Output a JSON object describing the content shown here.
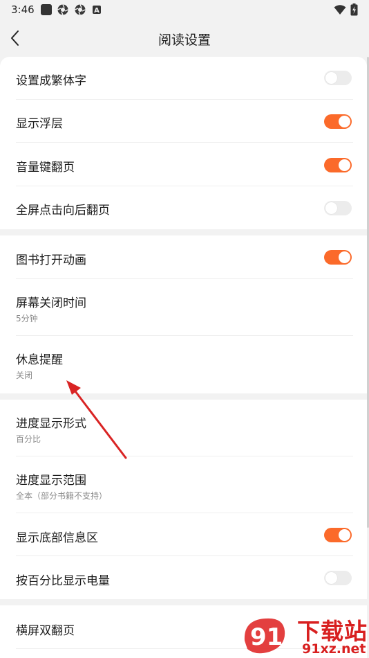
{
  "status_bar": {
    "time": "3:46",
    "icons": [
      "notification-square-icon",
      "aperture-icon",
      "aperture-icon",
      "a-badge-icon"
    ],
    "right_icons": [
      "wifi-icon",
      "battery-charging-icon"
    ]
  },
  "header": {
    "back_icon": "chevron-left-icon",
    "title": "阅读设置"
  },
  "accent_color": "#fb6a2a",
  "settings": {
    "traditional_chinese": {
      "label": "设置成繁体字",
      "enabled": false
    },
    "show_overlay": {
      "label": "显示浮层",
      "enabled": true
    },
    "volume_key_turn": {
      "label": "音量键翻页",
      "enabled": true
    },
    "fullscreen_tap_next": {
      "label": "全屏点击向后翻页",
      "enabled": false
    },
    "book_open_animation": {
      "label": "图书打开动画",
      "enabled": true
    },
    "screen_off_time": {
      "label": "屏幕关闭时间",
      "value": "5分钟"
    },
    "rest_reminder": {
      "label": "休息提醒",
      "value": "关闭"
    },
    "progress_format": {
      "label": "进度显示形式",
      "value": "百分比"
    },
    "progress_range": {
      "label": "进度显示范围",
      "value": "全本（部分书籍不支持）"
    },
    "bottom_info_area": {
      "label": "显示底部信息区",
      "enabled": true
    },
    "battery_percent": {
      "label": "按百分比显示电量",
      "enabled": false
    },
    "landscape_double_page": {
      "label": "横屏双翻页"
    }
  },
  "watermark": {
    "logo_text": "91",
    "line1": "下载站",
    "line2": "91xz.net"
  }
}
